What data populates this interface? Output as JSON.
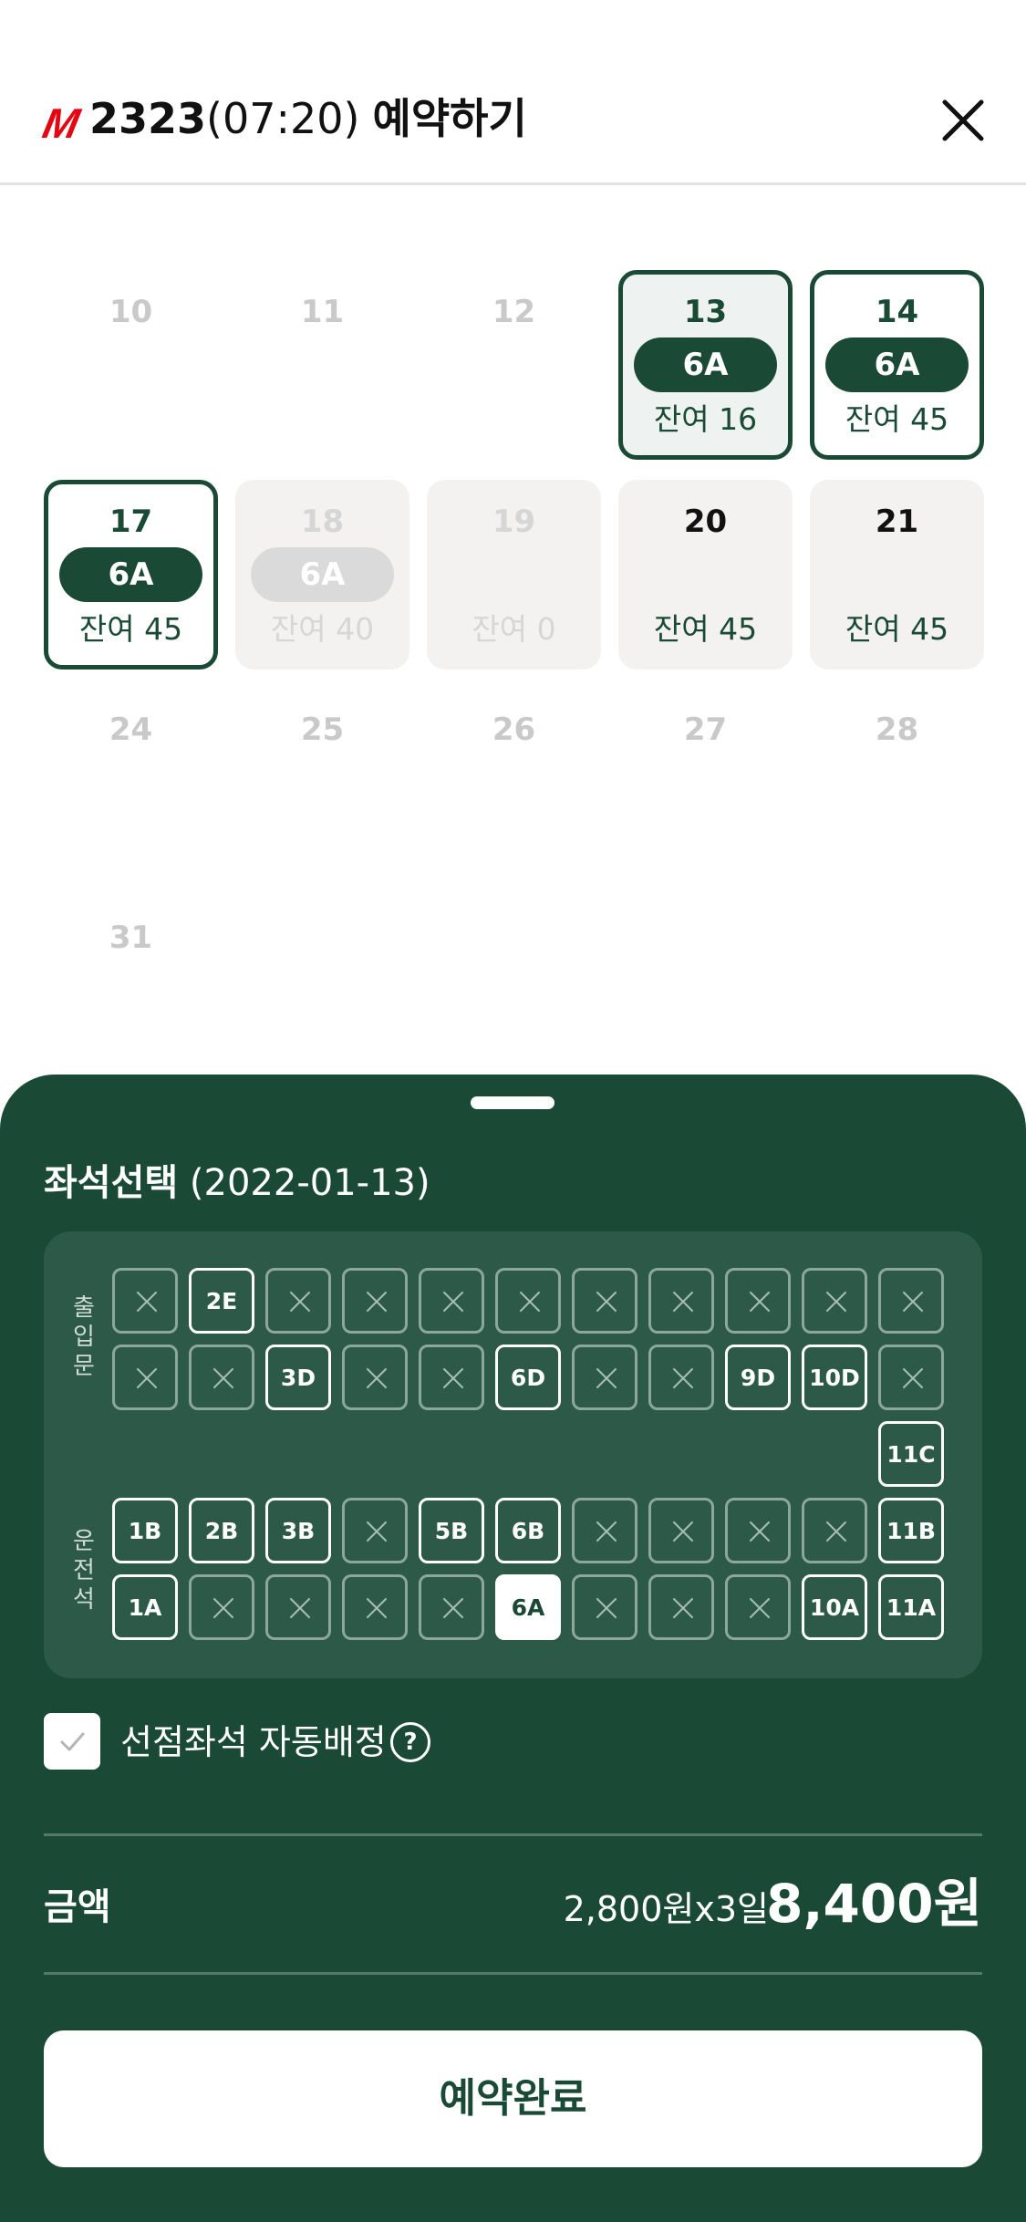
{
  "header": {
    "logo_mark": "M",
    "route_number": "2323",
    "time": "(07:20)",
    "title_label": "예약하기",
    "close_icon": "close-icon"
  },
  "calendar": {
    "days": [
      {
        "day": "10",
        "state": "plain"
      },
      {
        "day": "11",
        "state": "plain"
      },
      {
        "day": "12",
        "state": "plain"
      },
      {
        "day": "13",
        "state": "selected",
        "seat": "6A",
        "remaining": "잔여 16"
      },
      {
        "day": "14",
        "state": "selected",
        "seat": "6A",
        "remaining": "잔여 45"
      },
      {
        "day": "17",
        "state": "selected",
        "seat": "6A",
        "remaining": "잔여 45"
      },
      {
        "day": "18",
        "state": "disabled",
        "seat": "6A",
        "remaining": "잔여 40"
      },
      {
        "day": "19",
        "state": "disabled",
        "remaining": "잔여 0"
      },
      {
        "day": "20",
        "state": "available",
        "remaining": "잔여 45"
      },
      {
        "day": "21",
        "state": "available",
        "remaining": "잔여 45"
      },
      {
        "day": "24",
        "state": "plain"
      },
      {
        "day": "25",
        "state": "plain"
      },
      {
        "day": "26",
        "state": "plain"
      },
      {
        "day": "27",
        "state": "plain"
      },
      {
        "day": "28",
        "state": "plain"
      },
      {
        "day": "31",
        "state": "plain"
      }
    ]
  },
  "sheet": {
    "title_bold": "좌석선택",
    "title_date": "(2022-01-13)",
    "door_label": "출\n입\n문",
    "driver_label": "운\n전\n석",
    "rows": [
      [
        "x",
        "2E",
        "x",
        "x",
        "x",
        "x",
        "x",
        "x",
        "x",
        "x",
        "x"
      ],
      [
        "x",
        "x",
        "3D",
        "x",
        "x",
        "6D",
        "x",
        "x",
        "9D",
        "10D",
        "x"
      ],
      [
        "",
        "",
        "",
        "",
        "",
        "",
        "",
        "",
        "",
        "",
        "11C"
      ],
      [
        "1B",
        "2B",
        "3B",
        "x",
        "5B",
        "6B",
        "x",
        "x",
        "x",
        "x",
        "11B"
      ],
      [
        "1A",
        "x",
        "x",
        "x",
        "x",
        "6A",
        "x",
        "x",
        "x",
        "10A",
        "11A"
      ]
    ],
    "selected_seat": "6A",
    "auto_assign_label": "선점좌석 자동배정",
    "auto_assign_checked": true,
    "help_symbol": "?",
    "price_label": "금액",
    "price_unit": "2,800원x3일",
    "price_total": "8,400원",
    "submit_label": "예약완료"
  },
  "colors": {
    "primary": "#1a4a36",
    "logo_red": "#e30613",
    "seat_box": "#2d5a48"
  }
}
